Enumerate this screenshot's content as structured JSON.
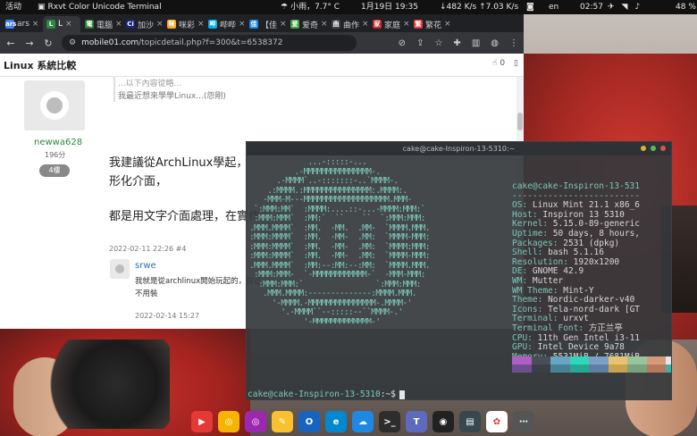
{
  "top_panel": {
    "activities": "活动",
    "app_name": "Rxvt Color Unicode Terminal",
    "weather": "小雨，7.7° C",
    "clock": "1月19日 19:35",
    "net_speed": "↓482 K/s ↑7.03 K/s",
    "language": "en",
    "time2": "02:57",
    "battery": "48 %"
  },
  "browser": {
    "tabs": [
      {
        "icon_label": "ars",
        "label": "ars",
        "color": "#4285f4"
      },
      {
        "icon_label": "L",
        "label": "L",
        "color": "#2b8a3e"
      },
      {
        "icon_label": "電",
        "label": "電腦",
        "color": "#2e7d32"
      },
      {
        "icon_label": "Ci",
        "label": "加沙",
        "color": "#1a237e"
      },
      {
        "icon_label": "咪",
        "label": "咪彩",
        "color": "#f9a825"
      },
      {
        "icon_label": "哔",
        "label": "哔哔",
        "color": "#00aeec"
      },
      {
        "icon_label": "佳",
        "label": "【佳",
        "color": "#1e88e5"
      },
      {
        "icon_label": "爱",
        "label": "爱奇",
        "color": "#43a047"
      },
      {
        "icon_label": "曲",
        "label": "曲作",
        "color": "#444444"
      },
      {
        "icon_label": "家",
        "label": "家庭",
        "color": "#c62828"
      },
      {
        "icon_label": "繁",
        "label": "繁花",
        "color": "#e53935"
      }
    ],
    "url_host": "mobile01.com",
    "url_path": "/topicdetail.php?f=300&t=6538372",
    "page_title": "Linux 系統比較",
    "like_count": "0",
    "quote_line1": "...以下內容從略...",
    "quote_line2": "我最近想來學學Linux...(怨剛)",
    "user": {
      "name": "newwa628",
      "score": "196分",
      "floor": "4樓"
    },
    "post_lines": [
      "我建議從ArchLinux學起，",
      "形化介面，",
      "都是用文字介面處理，在實作"
    ],
    "post_date": "2022-02-11 22:26 #4",
    "reply": {
      "name": "srwe",
      "text_line1": "我就是從archlinux開始玩起的，自己",
      "text_line2": "不用裝",
      "date": "2022-02-14 15:27"
    }
  },
  "terminal": {
    "title": "cake@cake-Inspiron-13-5310:~",
    "ascii_art": [
      "             ...-:::::-...",
      "          .-MMMMMMMMMMMMMMM-.",
      "      .-MMMM`..-:::::::-..`MMMM-.",
      "    .:MMMM.:MMMMMMMMMMMMMMM:.MMMM:.",
      "   -MMM-M---MMMMMMMMMMMMMMMMMMM.MMM-",
      " `:MMM:MM`  :MMMM:....::-...-MMMM:MMM:`",
      " :MMM:MMM`  :MM:`  ``    ``  `:MMM:MMM:",
      ".MMM.MMMM`  :MM.  -MM.  .MM-  `MMMM.MMM.",
      ":MMM:MMMM`  :MM.  -MM-  .MM:  `MMMM-MMM:",
      ":MMM:MMMM`  :MM.  -MM-  .MM:  `MMMM:MMM:",
      ":MMM:MMMM`  :MM.  -MM-  .MM:  `MMMM-MMM:",
      ".MMM.MMMM`  :MM:--:MM:--:MM:  `MMMM.MMM.",
      " :MMM:MMM-  `-MMMMMMMMMMMM-`  -MMM-MMM:",
      "  :MMM:MMM:`                `:MMM:MMM:",
      "   .MMM.MMMM:--------------:MMMM.MMM.",
      "     '-MMMM.-MMMMMMMMMMMMMMM-.MMMM-'",
      "       '.-MMMM``--:::::--``MMMM-.'",
      "            '-MMMMMMMMMMMMM-'",
      "               ``-:::::-``"
    ],
    "info_head": "cake@cake-Inspiron-13-531",
    "info_sep": "-------------------------",
    "info": [
      {
        "key": "OS",
        "value": "Linux Mint 21.1 x86_6"
      },
      {
        "key": "Host",
        "value": "Inspiron 13 5310"
      },
      {
        "key": "Kernel",
        "value": "5.15.0-89-generic"
      },
      {
        "key": "Uptime",
        "value": "50 days, 8 hours,"
      },
      {
        "key": "Packages",
        "value": "2531 (dpkg)"
      },
      {
        "key": "Shell",
        "value": "bash 5.1.16"
      },
      {
        "key": "Resolution",
        "value": "1920x1200"
      },
      {
        "key": "DE",
        "value": "GNOME 42.9"
      },
      {
        "key": "WM",
        "value": "Mutter"
      },
      {
        "key": "WM Theme",
        "value": "Mint-Y"
      },
      {
        "key": "Theme",
        "value": "Nordic-darker-v40"
      },
      {
        "key": "Icons",
        "value": "Tela-nord-dark [GT"
      },
      {
        "key": "Terminal",
        "value": "urxvt"
      },
      {
        "key": "Terminal Font",
        "value": "方正兰亭"
      },
      {
        "key": "CPU",
        "value": "11th Gen Intel i3-11"
      },
      {
        "key": "GPU",
        "value": "Intel Device 9a78"
      },
      {
        "key": "Memory",
        "value": "5531MiB / 7681MiB"
      }
    ],
    "swatches_top": [
      "#b05ec6",
      "#4a4f57",
      "#66a6c0",
      "#2fd7b9",
      "#7e9fc5",
      "#e8c36f",
      "#98c49a",
      "#d59a7b",
      "#e6e6e6"
    ],
    "swatches_bottom": [
      "#6e4f8e",
      "#3b4048",
      "#4a7f98",
      "#24a88f",
      "#5f7ea4",
      "#c9a24f",
      "#7aa27c",
      "#b57a5e",
      "#3fb0a6"
    ],
    "prompt_user": "cake@cake-Inspiron-13-5310",
    "prompt_tail": ":~$"
  },
  "dock": [
    {
      "name": "youtube",
      "color": "#e53935",
      "glyph": "▶"
    },
    {
      "name": "chrome",
      "color": "#f4b400",
      "glyph": "◎"
    },
    {
      "name": "chrome-canary",
      "color": "#9c27b0",
      "glyph": "◎"
    },
    {
      "name": "stickies",
      "color": "#fbc02d",
      "glyph": "✎"
    },
    {
      "name": "outlook",
      "color": "#1565c0",
      "glyph": "O"
    },
    {
      "name": "edge",
      "color": "#0288d1",
      "glyph": "e"
    },
    {
      "name": "onedrive",
      "color": "#1e88e5",
      "glyph": "☁"
    },
    {
      "name": "terminal",
      "color": "#2d2d2d",
      "glyph": ">_"
    },
    {
      "name": "teams",
      "color": "#5c6bc0",
      "glyph": "T"
    },
    {
      "name": "github",
      "color": "#222222",
      "glyph": "◉"
    },
    {
      "name": "files",
      "color": "#37474f",
      "glyph": "▤"
    },
    {
      "name": "photos",
      "color": "#ffffff",
      "glyph": "✿"
    },
    {
      "name": "apps-grid",
      "color": "#555555",
      "glyph": "⋯"
    }
  ]
}
